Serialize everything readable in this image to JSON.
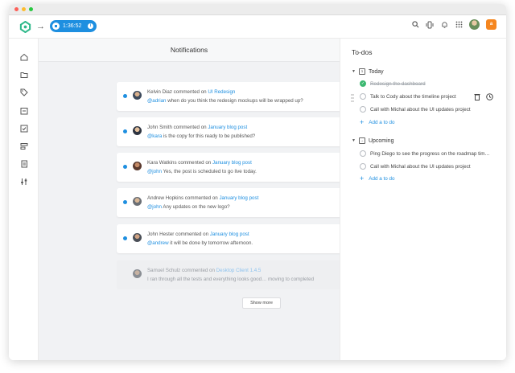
{
  "window": {
    "traffic_lights": [
      "#fc6058",
      "#fdbc2e",
      "#28c840"
    ]
  },
  "topbar": {
    "timer": "1:36:52",
    "timer_info": "i",
    "badge_letter": "a",
    "icons": [
      "search-icon",
      "focus-icon",
      "bell-icon",
      "apps-grid-icon"
    ]
  },
  "sidebar": {
    "items": [
      "home-icon",
      "folder-icon",
      "tag-icon",
      "calendar-icon",
      "check-square-icon",
      "layers-icon",
      "document-icon",
      "settings-sliders-icon"
    ]
  },
  "notifications": {
    "title": "Notifications",
    "items": [
      {
        "name": "Kelvin Diaz",
        "verb": " commented on ",
        "target": "UI Redesign",
        "mention": "@adrian",
        "message": " when do you think the redesign mockups will be wrapped up?",
        "unread": true
      },
      {
        "name": "John Smith",
        "verb": " commented on ",
        "target": "January blog post",
        "mention": "@kara",
        "message": " is the copy for this ready to be published?",
        "unread": true
      },
      {
        "name": "Kara Watkins",
        "verb": " commented on ",
        "target": "January blog post",
        "mention": "@john",
        "message": " Yes, the post is scheduled to go live today.",
        "unread": true
      },
      {
        "name": "Andrew Hopkins",
        "verb": " commented on ",
        "target": "January blog post",
        "mention": "@john",
        "message": " Any updates on the new logo?",
        "unread": true
      },
      {
        "name": "John Hester",
        "verb": " commented on ",
        "target": "January blog post",
        "mention": "@andrew",
        "message": " it will be done by tomorrow afternoon.",
        "unread": true
      },
      {
        "name": "Samuel Schulz",
        "verb": " commented on ",
        "target": "Desktop Client 1.4.5",
        "mention": "",
        "message": "I ran through all the tests and everything looks good… moving to completed",
        "unread": false
      }
    ],
    "show_more": "Show more"
  },
  "todos": {
    "title": "To-dos",
    "today": {
      "label": "Today",
      "icon_number": "1",
      "items": [
        {
          "text": "Redesign the dashboard",
          "done": true
        },
        {
          "text": "Talk to Cody about the timeline project",
          "done": false
        },
        {
          "text": "Call with Michal about the UI updates project",
          "done": false
        }
      ],
      "add": "Add a to do"
    },
    "upcoming": {
      "label": "Upcoming",
      "items": [
        {
          "text": "Ping Diego to see the progress on the roadmap tim…",
          "done": false
        },
        {
          "text": "Call with Michal about the UI updates project",
          "done": false
        }
      ],
      "add": "Add a to do"
    }
  }
}
